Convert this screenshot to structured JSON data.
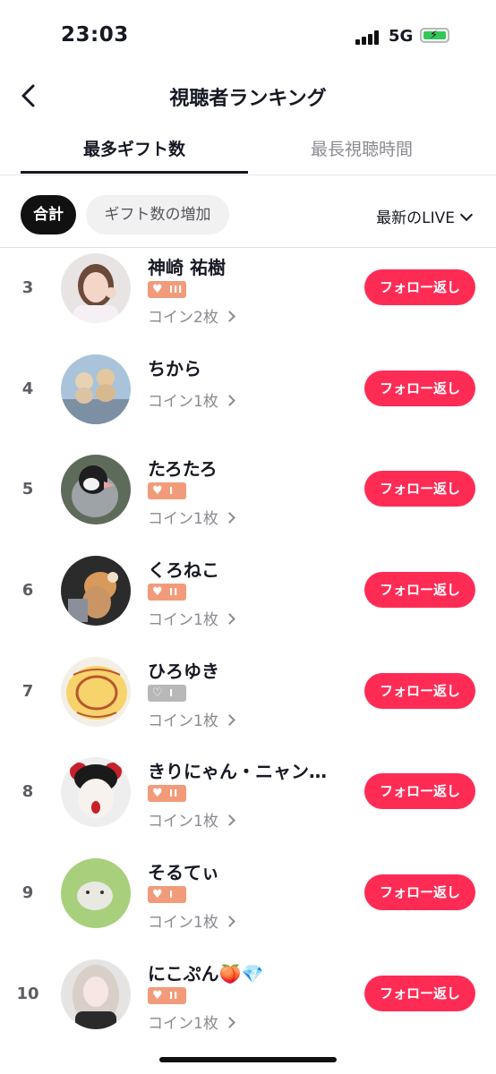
{
  "status_bar": {
    "time": "23:03",
    "network": "5G"
  },
  "header": {
    "title": "視聴者ランキング"
  },
  "tabs": [
    {
      "label": "最多ギフト数",
      "active": true
    },
    {
      "label": "最長視聴時間",
      "active": false
    }
  ],
  "filters": {
    "total_label": "合計",
    "increase_label": "ギフト数の増加",
    "sort_label": "最新のLIVE"
  },
  "follow_label": "フォロー返し",
  "colors": {
    "accent": "#fe2c55",
    "badge_orange": "#f29b7b",
    "badge_gray": "#b8b8b8"
  },
  "viewers": [
    {
      "rank": "3",
      "name": "神崎 祐樹",
      "badge_level": "III",
      "badge_color": "orange",
      "coins": "コイン2枚"
    },
    {
      "rank": "4",
      "name": "ちから",
      "badge_level": "",
      "badge_color": "none",
      "coins": "コイン1枚"
    },
    {
      "rank": "5",
      "name": "たろたろ",
      "badge_level": "I",
      "badge_color": "orange",
      "coins": "コイン1枚"
    },
    {
      "rank": "6",
      "name": "くろねこ",
      "badge_level": "II",
      "badge_color": "orange",
      "coins": "コイン1枚"
    },
    {
      "rank": "7",
      "name": "ひろゆき",
      "badge_level": "I",
      "badge_color": "gray",
      "coins": "コイン1枚"
    },
    {
      "rank": "8",
      "name": "きりにゃん・ニャン…",
      "badge_level": "II",
      "badge_color": "orange",
      "coins": "コイン1枚"
    },
    {
      "rank": "9",
      "name": "そるてぃ",
      "badge_level": "I",
      "badge_color": "orange",
      "coins": "コイン1枚"
    },
    {
      "rank": "10",
      "name": "にこぷん🍑💎",
      "badge_level": "II",
      "badge_color": "orange",
      "coins": "コイン1枚"
    }
  ]
}
